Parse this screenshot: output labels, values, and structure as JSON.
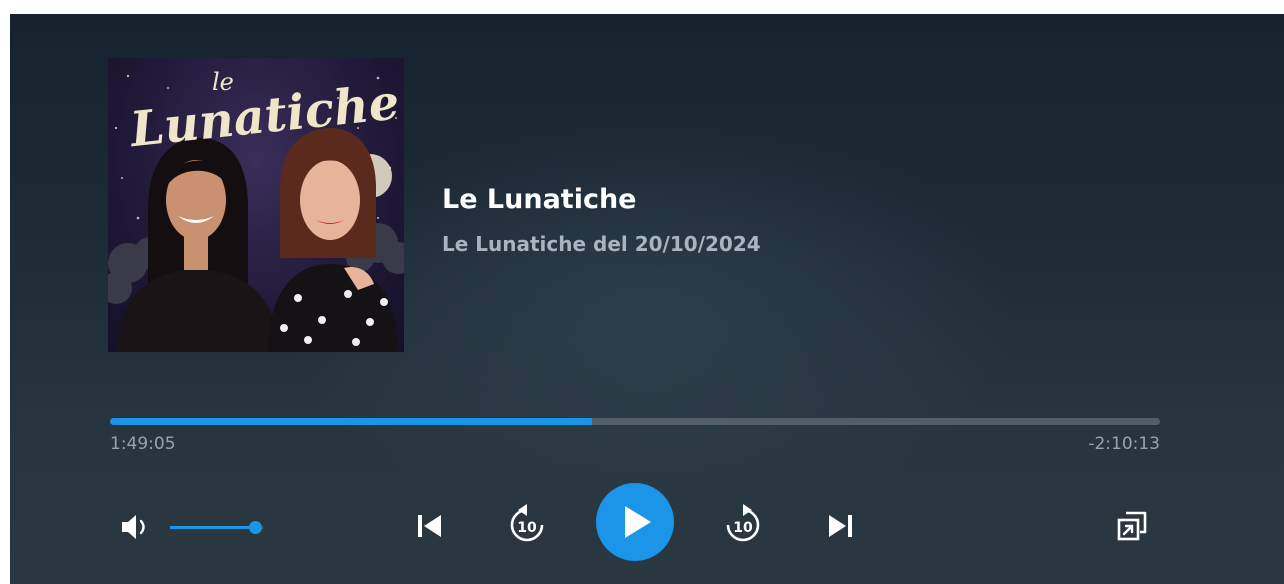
{
  "episode": {
    "show_title": "Le Lunatiche",
    "episode_title": "Le Lunatiche del 20/10/2024",
    "artwork_text_small": "le",
    "artwork_text_large": "Lunatiche"
  },
  "progress": {
    "elapsed": "1:49:05",
    "remaining": "-2:10:13",
    "fraction": 0.459
  },
  "volume": {
    "level": 0.92
  },
  "controls": {
    "rewind_seconds": "10",
    "forward_seconds": "10"
  },
  "icons": {
    "volume": "speaker-icon",
    "previous": "skip-previous-icon",
    "rewind": "rewind-10-icon",
    "play": "play-icon",
    "forward": "forward-10-icon",
    "next": "skip-next-icon",
    "miniplayer": "picture-in-picture-icon"
  },
  "colors": {
    "accent": "#1a95e8",
    "background": "#1c2a36",
    "track": "#525d69",
    "title": "#ffffff",
    "subtitle": "#aab4bf",
    "time": "#98a2ad"
  }
}
